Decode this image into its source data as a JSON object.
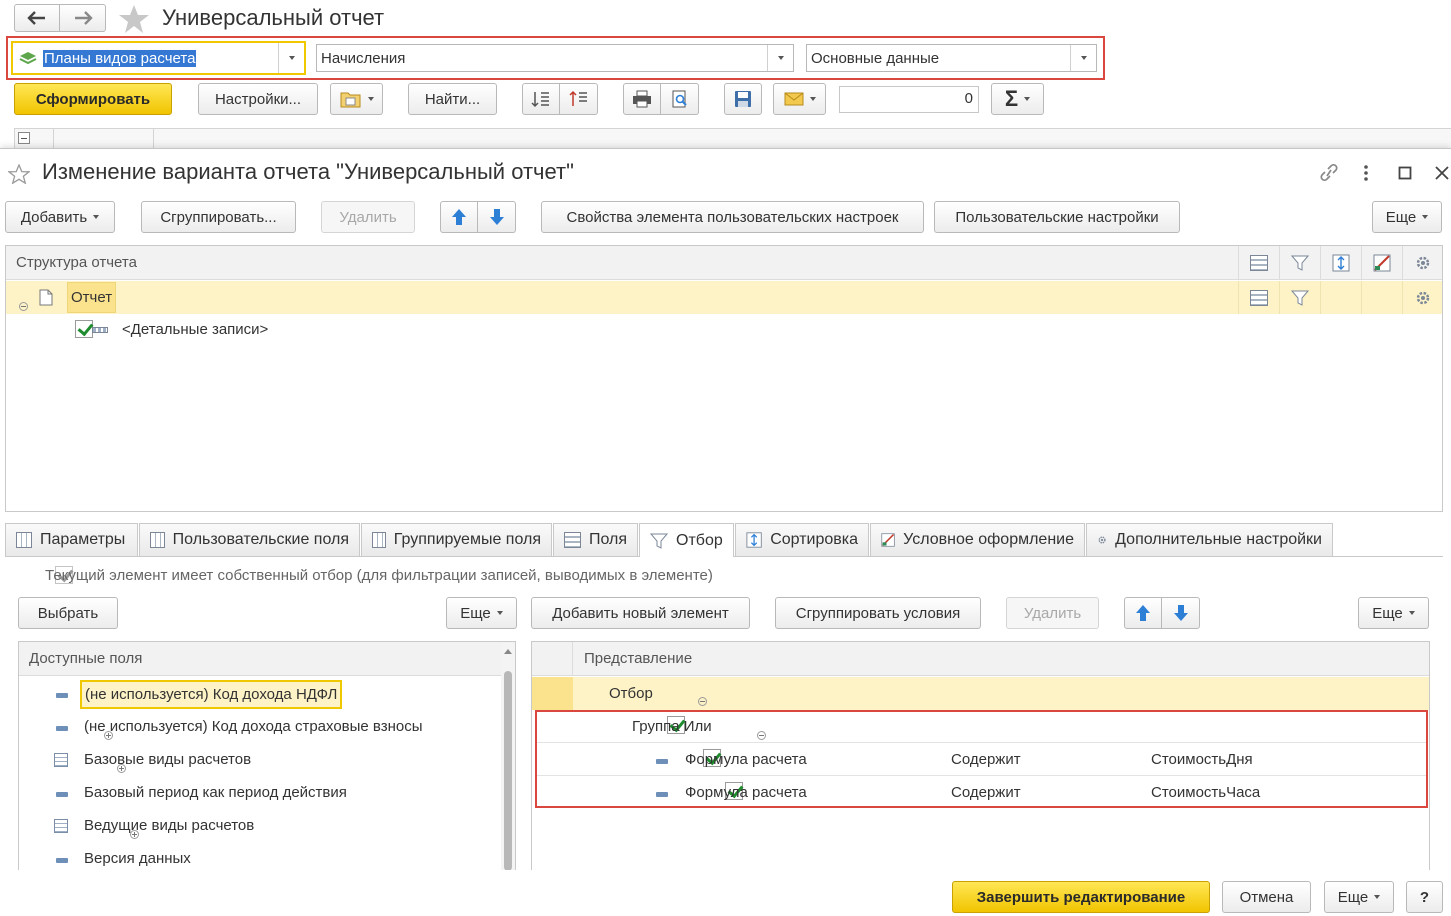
{
  "window": {
    "title": "Универсальный отчет",
    "report_type": "Планы видов расчета",
    "report_object": "Начисления",
    "data_source": "Основные данные",
    "toolbar": {
      "generate": "Сформировать",
      "settings": "Настройки...",
      "find": "Найти...",
      "counter_value": "0"
    }
  },
  "dialog": {
    "title": "Изменение варианта отчета \"Универсальный отчет\"",
    "toolbar": {
      "add": "Добавить",
      "group": "Сгруппировать...",
      "delete": "Удалить",
      "element_props": "Свойства элемента пользовательских настроек",
      "user_settings": "Пользовательские настройки",
      "more": "Еще"
    },
    "structure": {
      "header": "Структура отчета",
      "root": "Отчет",
      "detail": "<Детальные записи>"
    },
    "tabs": [
      {
        "label": "Параметры"
      },
      {
        "label": "Пользовательские поля"
      },
      {
        "label": "Группируемые поля"
      },
      {
        "label": "Поля"
      },
      {
        "label": "Отбор"
      },
      {
        "label": "Сортировка"
      },
      {
        "label": "Условное оформление"
      },
      {
        "label": "Дополнительные настройки"
      }
    ],
    "filter": {
      "own_filter_label": "Текущий элемент имеет собственный отбор (для фильтрации записей, выводимых в элементе)",
      "left_toolbar": {
        "select": "Выбрать",
        "more": "Еще"
      },
      "right_toolbar": {
        "add_new": "Добавить новый элемент",
        "group_conditions": "Сгруппировать условия",
        "delete": "Удалить",
        "more": "Еще"
      },
      "available_fields_header": "Доступные поля",
      "available_fields": [
        {
          "label": "(не используется) Код дохода НДФЛ"
        },
        {
          "label": "(не используется) Код дохода страховые взносы"
        },
        {
          "label": "Базовые виды расчетов"
        },
        {
          "label": "Базовый период как период действия"
        },
        {
          "label": "Ведущие виды расчетов"
        },
        {
          "label": "Версия данных"
        }
      ],
      "representation_header": "Представление",
      "root": "Отбор",
      "group": "Группа Или",
      "conditions": [
        {
          "field": "Формула расчета",
          "comparison": "Содержит",
          "value": "СтоимостьДня"
        },
        {
          "field": "Формула расчета",
          "comparison": "Содержит",
          "value": "СтоимостьЧаса"
        }
      ]
    },
    "footer": {
      "finish": "Завершить редактирование",
      "cancel": "Отмена",
      "more": "Еще",
      "help": "?"
    }
  },
  "colors": {
    "highlight_red": "#d9473f",
    "selection_yellow": "#fdf3c6",
    "primary_yellow": "#f5cf15",
    "check_green": "#1f8c2e"
  }
}
